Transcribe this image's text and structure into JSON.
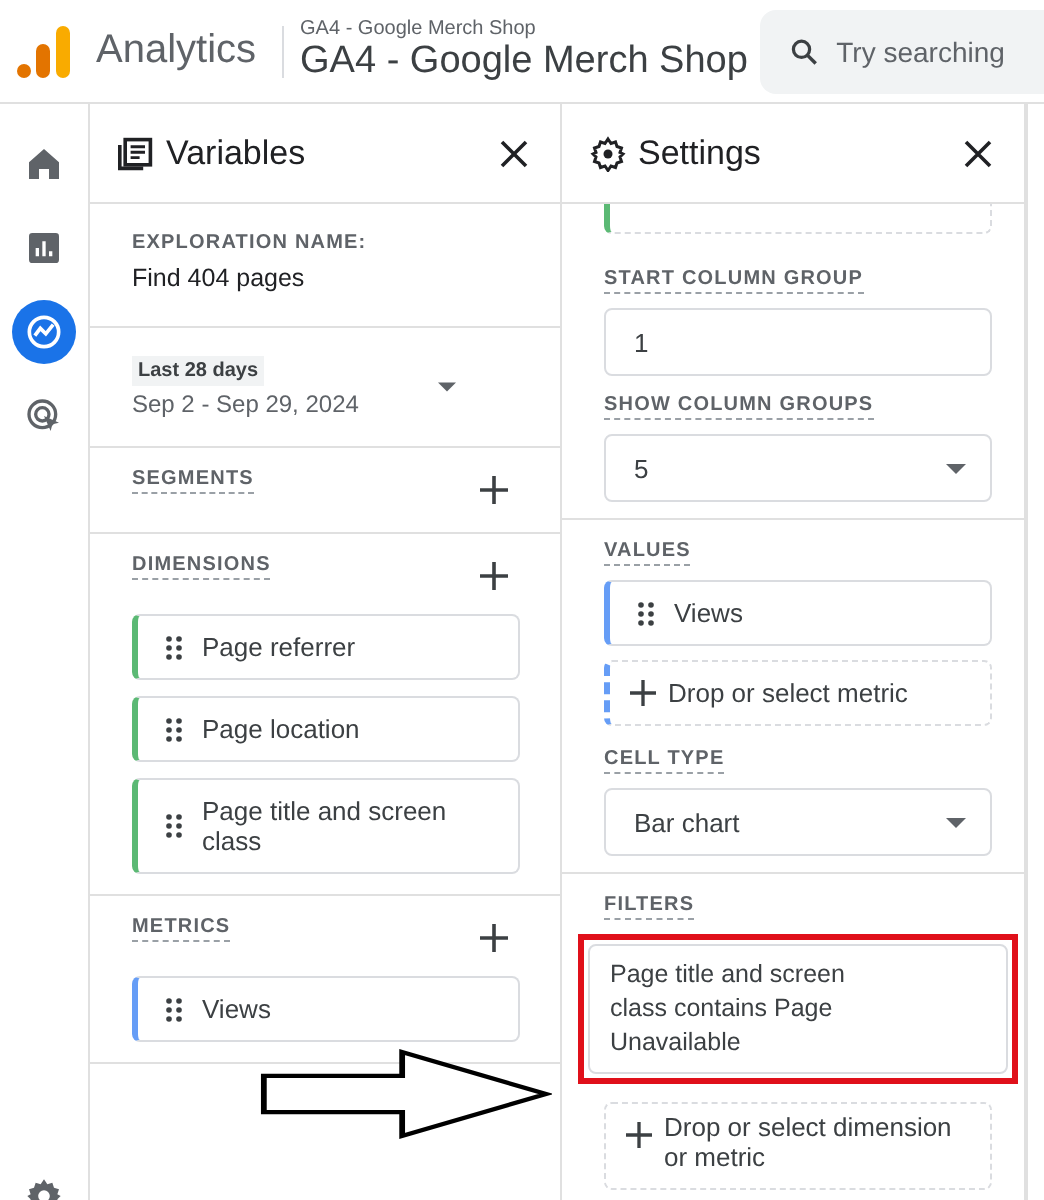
{
  "header": {
    "product": "Analytics",
    "account": "GA4 - Google Merch Shop",
    "property": "GA4 - Google Merch Shop",
    "search": {
      "placeholder": "Try searching"
    }
  },
  "nav": [
    {
      "kind": "home",
      "selected": false
    },
    {
      "kind": "reports",
      "selected": false
    },
    {
      "kind": "explore",
      "selected": true
    },
    {
      "kind": "advertising",
      "selected": false
    },
    {
      "kind": "admin",
      "selected": false
    }
  ],
  "variables": {
    "title": "Variables",
    "exploration_label": "EXPLORATION NAME:",
    "exploration_name": "Find 404 pages",
    "date_range": {
      "preset": "Last 28 days",
      "range": "Sep 2 - Sep 29, 2024"
    },
    "sections": [
      {
        "label": "SEGMENTS",
        "kind": "segment"
      },
      {
        "label": "DIMENSIONS",
        "kind": "dimension",
        "items": [
          "Page referrer",
          "Page location",
          "Page title and screen class"
        ]
      },
      {
        "label": "METRICS",
        "kind": "metric",
        "items": [
          "Views"
        ]
      }
    ]
  },
  "settings": {
    "title": "Settings",
    "fields": [
      {
        "kind": "input",
        "label": "START COLUMN GROUP",
        "value": "1"
      },
      {
        "kind": "select",
        "label": "SHOW COLUMN GROUPS",
        "value": "5"
      }
    ],
    "values": {
      "label": "VALUES",
      "items": [
        "Views"
      ],
      "drop": "Drop or select metric"
    },
    "cell_type": {
      "kind": "select",
      "label": "CELL TYPE",
      "value": "Bar chart"
    },
    "filters": {
      "label": "FILTERS",
      "items": [
        {
          "text": "Page title and screen class contains Page Unavailable",
          "highlighted": true
        }
      ],
      "drop": "Drop or select dimension or metric"
    }
  }
}
